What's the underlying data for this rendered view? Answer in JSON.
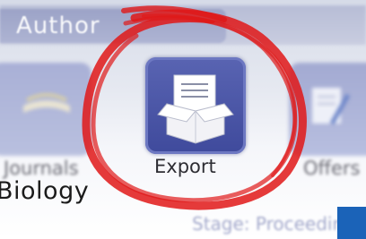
{
  "header": {
    "title": "Author"
  },
  "tiles": [
    {
      "label": "Journals",
      "icon": "book-icon"
    },
    {
      "label": "Export",
      "icon": "export-box-icon"
    },
    {
      "label": "Offers",
      "icon": "offers-pen-icon"
    }
  ],
  "subject": "Biology",
  "status": "Stage: Proceeding is",
  "colors": {
    "export_tile": "#4a55a6",
    "annotation": "#e01818",
    "accent_block": "#1b63b8"
  }
}
